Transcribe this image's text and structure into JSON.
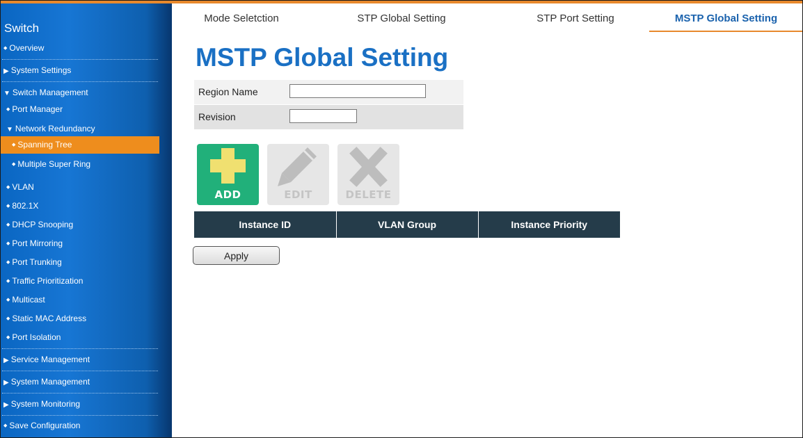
{
  "sidebar": {
    "brand": "Switch",
    "items": [
      {
        "label": "Overview",
        "marker": "◆"
      },
      {
        "label": "System Settings",
        "marker": "▶"
      },
      {
        "label": "Switch Management",
        "marker": "▼"
      },
      {
        "label": "Port Manager",
        "marker": "◆"
      },
      {
        "label": "Network Redundancy",
        "marker": "▼"
      },
      {
        "label": "Spanning Tree",
        "marker": "◆"
      },
      {
        "label": "Multiple Super Ring",
        "marker": "◆"
      },
      {
        "label": "VLAN",
        "marker": "◆"
      },
      {
        "label": "802.1X",
        "marker": "◆"
      },
      {
        "label": "DHCP Snooping",
        "marker": "◆"
      },
      {
        "label": "Port Mirroring",
        "marker": "◆"
      },
      {
        "label": "Port Trunking",
        "marker": "◆"
      },
      {
        "label": "Traffic Prioritization",
        "marker": "◆"
      },
      {
        "label": "Multicast",
        "marker": "◆"
      },
      {
        "label": "Static MAC Address",
        "marker": "◆"
      },
      {
        "label": "Port Isolation",
        "marker": "◆"
      },
      {
        "label": "Service Management",
        "marker": "▶"
      },
      {
        "label": "System Management",
        "marker": "▶"
      },
      {
        "label": "System Monitoring",
        "marker": "▶"
      },
      {
        "label": "Save Configuration",
        "marker": "◆"
      }
    ],
    "active_item": "Spanning Tree"
  },
  "tabs": [
    {
      "label": "Mode Seletction"
    },
    {
      "label": "STP Global Setting"
    },
    {
      "label": "STP Port Setting"
    },
    {
      "label": "MSTP Global Setting"
    }
  ],
  "active_tab": "MSTP Global Setting",
  "page_title": "MSTP Global Setting",
  "form": {
    "region_name_label": "Region Name",
    "region_name_value": "",
    "revision_label": "Revision",
    "revision_value": ""
  },
  "actions": {
    "add": "ADD",
    "edit": "EDIT",
    "delete": "DELETE"
  },
  "table": {
    "columns": [
      "Instance ID",
      "VLAN Group",
      "Instance Priority"
    ]
  },
  "apply_label": "Apply",
  "colors": {
    "accent_orange": "#e8892c",
    "sidebar_blue": "#1776d4",
    "title_blue": "#1a70c4",
    "add_green": "#21b07a",
    "table_header": "#253c4a"
  }
}
